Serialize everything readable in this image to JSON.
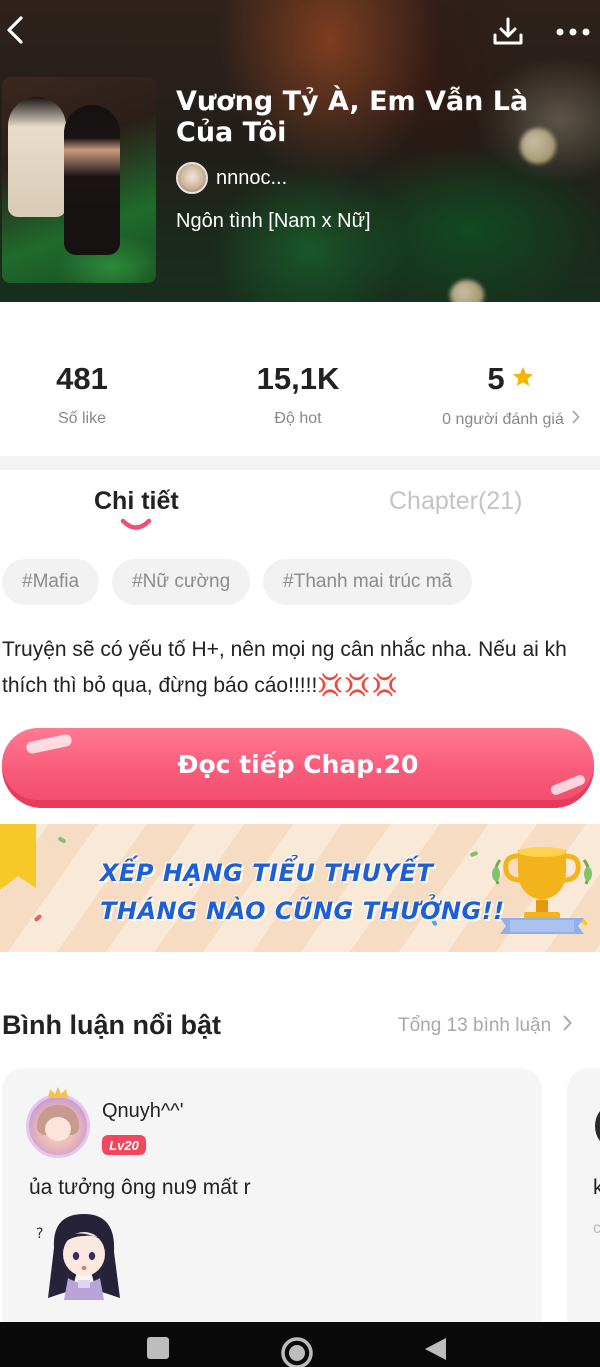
{
  "header": {
    "title": "Vương Tỷ À, Em Vẫn Là Của Tôi",
    "author": "nnnoc...",
    "genre": "Ngôn tình [Nam x Nữ]"
  },
  "stats": {
    "likes": {
      "value": "481",
      "label": "Số like"
    },
    "hot": {
      "value": "15,1K",
      "label": "Độ hot"
    },
    "rating": {
      "value": "5",
      "label": "0 người đánh giá"
    }
  },
  "tabs": {
    "detail": "Chi tiết",
    "chapter": "Chapter(21)"
  },
  "tags": [
    "#Mafia",
    "#Nữ cường",
    "#Thanh mai trúc mã"
  ],
  "description": {
    "text": "Truyện sẽ có yếu tố H+, nên mọi ng cân nhắc nha. Nếu ai kh thích thì bỏ qua, đừng báo cáo!!!!!",
    "emoji": "💢💢💢"
  },
  "read_button": {
    "label": "Đọc tiếp Chap.20"
  },
  "banner": {
    "line1": "XẾP HẠNG TIỂU THUYẾT",
    "line2": "THÁNG NÀO CŨNG THƯỞNG!!"
  },
  "comments": {
    "title": "Bình luận nổi bật",
    "total": "Tổng 13 bình luận",
    "items": [
      {
        "user": "Qnuyh^^'",
        "level": "Lv20",
        "text": "ủa tưởng ông nu9 mất r"
      }
    ],
    "peek": {
      "text": "k",
      "sub": "c"
    }
  },
  "colors": {
    "accent": "#f95d7b",
    "level_badge": "#f0475f",
    "star": "#f7b500",
    "banner_text": "#1e5fd6"
  },
  "icons": {
    "back": "chevron-left-icon",
    "download": "download-icon",
    "more": "more-icon",
    "star": "star-icon",
    "chevron": "chevron-right-icon"
  }
}
